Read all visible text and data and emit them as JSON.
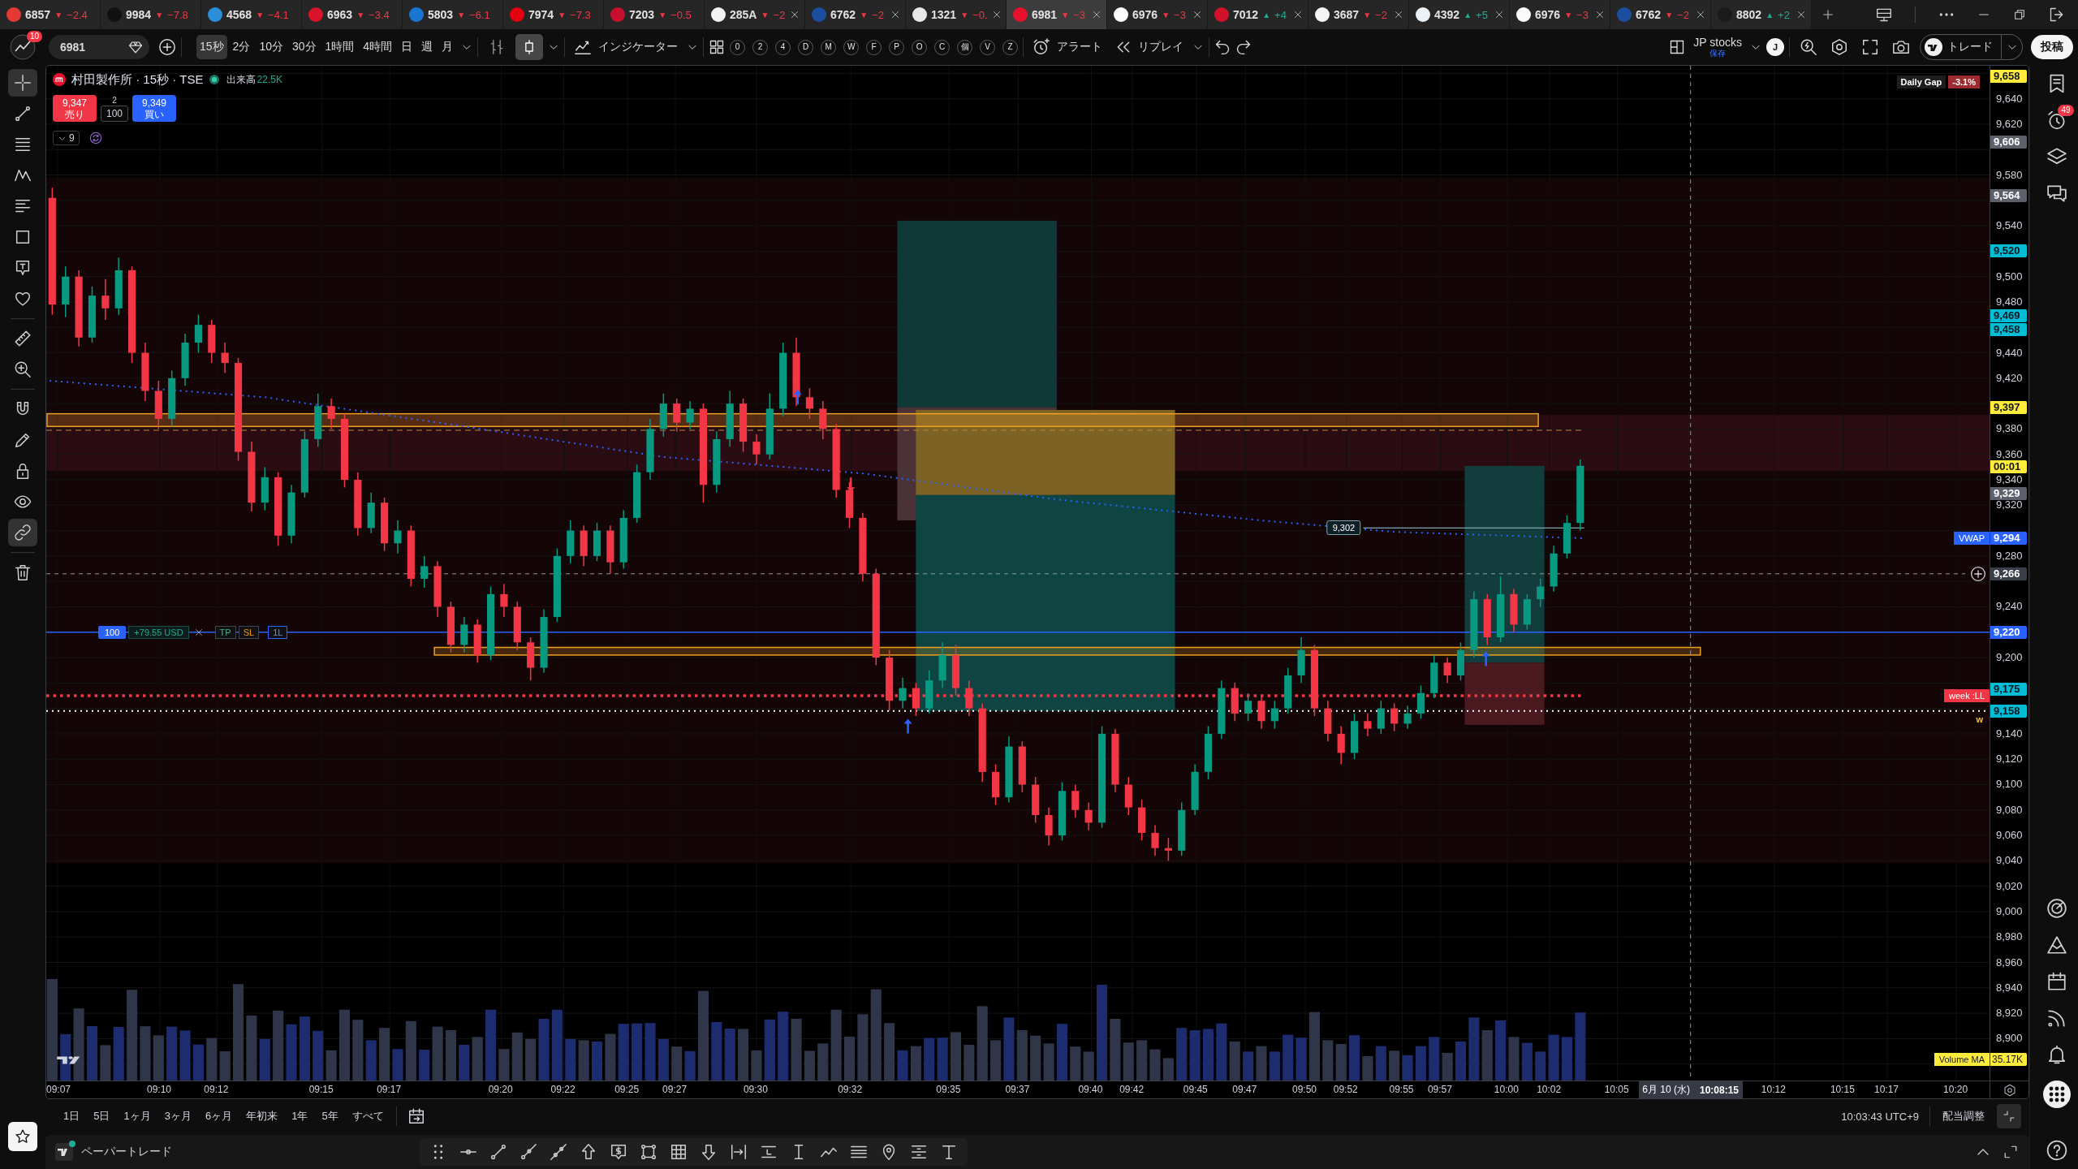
{
  "tabs": [
    {
      "symbol": "6857",
      "arrow": "▼",
      "change": "−2.4",
      "color": "#f23645",
      "logo": {
        "color": "#e53935"
      },
      "close_button": false,
      "selected": false
    },
    {
      "symbol": "9984",
      "arrow": "▼",
      "change": "−7.8",
      "color": "#f23645",
      "logo": {
        "color": "#111111"
      },
      "close_button": false,
      "selected": false
    },
    {
      "symbol": "4568",
      "arrow": "▼",
      "change": "−4.1",
      "color": "#f23645",
      "logo": {
        "color": "#2a8fd8"
      },
      "close_button": false,
      "selected": false
    },
    {
      "symbol": "6963",
      "arrow": "▼",
      "change": "−3.4",
      "color": "#f23645",
      "logo": {
        "color": "#d7142a"
      },
      "close_button": false,
      "selected": false
    },
    {
      "symbol": "5803",
      "arrow": "▼",
      "change": "−6.1",
      "color": "#f23645",
      "logo": {
        "color": "#1976d2"
      },
      "close_button": false,
      "selected": false
    },
    {
      "symbol": "7974",
      "arrow": "▼",
      "change": "−7.3",
      "color": "#f23645",
      "logo": {
        "color": "#e4000f"
      },
      "close_button": false,
      "selected": false
    },
    {
      "symbol": "7203",
      "arrow": "▼",
      "change": "−0.5",
      "color": "#f23645",
      "logo": {
        "color": "#c8102e"
      },
      "close_button": false,
      "selected": false
    },
    {
      "symbol": "285A",
      "arrow": "▼",
      "change": "−2",
      "color": "#f23645",
      "logo": {
        "color": "#f2f2f2"
      },
      "close_button": true,
      "selected": false
    },
    {
      "symbol": "6762",
      "arrow": "▼",
      "change": "−2",
      "color": "#f23645",
      "logo": {
        "color": "#1c4ea0"
      },
      "close_button": true,
      "selected": false
    },
    {
      "symbol": "1321",
      "arrow": "▼",
      "change": "−0.",
      "color": "#f23645",
      "logo": {
        "color": "#e8e8e8"
      },
      "close_button": true,
      "selected": false
    },
    {
      "symbol": "6981",
      "arrow": "▼",
      "change": "−3",
      "color": "#f23645",
      "logo": {
        "color": "#e8112d"
      },
      "close_button": true,
      "selected": true
    },
    {
      "symbol": "6976",
      "arrow": "▼",
      "change": "−3",
      "color": "#f23645",
      "logo": {
        "color": "#fafafa"
      },
      "close_button": true,
      "selected": false
    },
    {
      "symbol": "7012",
      "arrow": "▲",
      "change": "+4",
      "color": "#22ab94",
      "logo": {
        "color": "#d3112a"
      },
      "close_button": true,
      "selected": false
    },
    {
      "symbol": "3687",
      "arrow": "▼",
      "change": "−2",
      "color": "#f23645",
      "logo": {
        "color": "#f5f5f5"
      },
      "close_button": true,
      "selected": false
    },
    {
      "symbol": "4392",
      "arrow": "▲",
      "change": "+5",
      "color": "#22ab94",
      "logo": {
        "color": "#eaf2f8"
      },
      "close_button": true,
      "selected": false
    },
    {
      "symbol": "6976",
      "arrow": "▼",
      "change": "−3",
      "color": "#f23645",
      "logo": {
        "color": "#fafafa"
      },
      "close_button": true,
      "selected": false
    },
    {
      "symbol": "6762",
      "arrow": "▼",
      "change": "−2",
      "color": "#f23645",
      "logo": {
        "color": "#1c4ea0"
      },
      "close_button": true,
      "selected": false
    },
    {
      "symbol": "8802",
      "arrow": "▲",
      "change": "+2",
      "color": "#22ab94",
      "logo": {
        "color": "#1a1a1a"
      },
      "close_button": true,
      "selected": false
    }
  ],
  "toolbar": {
    "notification_count": "10",
    "symbol": "6981",
    "intervals": [
      {
        "label": "15秒",
        "selected": true
      },
      {
        "label": "2分",
        "selected": false
      },
      {
        "label": "10分",
        "selected": false
      },
      {
        "label": "30分",
        "selected": false
      },
      {
        "label": "1時間",
        "selected": false
      },
      {
        "label": "4時間",
        "selected": false
      },
      {
        "label": "日",
        "selected": false
      },
      {
        "label": "週",
        "selected": false
      },
      {
        "label": "月",
        "selected": false
      }
    ],
    "chart_types": [
      {
        "kind": "candles",
        "selected": false
      },
      {
        "kind": "hollow",
        "selected": true
      }
    ],
    "indicators_label": "インジケーター",
    "quick_buttons": [
      "0",
      "2",
      "4",
      "D",
      "M",
      "W",
      "F",
      "P",
      "O",
      "C",
      "個",
      "V",
      "Z"
    ],
    "alert_label": "アラート",
    "replay_label": "リプレイ",
    "layout_name": "JP stocks",
    "layout_status": "保存",
    "user_initial": "J",
    "trade_label": "トレード",
    "publish_label": "投稿"
  },
  "left_toolbar": {
    "tool_groups": [
      {
        "tools": [
          {
            "kind": "crosshair",
            "selected": true
          },
          {
            "kind": "trendline",
            "selected": false
          },
          {
            "kind": "levels",
            "selected": false
          },
          {
            "kind": "pattern",
            "selected": false
          },
          {
            "kind": "lines",
            "selected": false
          },
          {
            "kind": "rectangle",
            "selected": false
          },
          {
            "kind": "note",
            "selected": false
          },
          {
            "kind": "heart",
            "selected": false
          }
        ]
      },
      {
        "tools": [
          {
            "kind": "ruler",
            "selected": false
          },
          {
            "kind": "zoom",
            "selected": false
          }
        ]
      },
      {
        "tools": [
          {
            "kind": "magnet",
            "selected": false
          },
          {
            "kind": "pencil",
            "selected": false
          },
          {
            "kind": "lock",
            "selected": false
          },
          {
            "kind": "eye",
            "selected": false
          },
          {
            "kind": "link",
            "selected": true
          }
        ]
      },
      {
        "tools": [
          {
            "kind": "trash",
            "selected": false
          }
        ]
      }
    ]
  },
  "chart": {
    "title": "村田製作所 · 15秒 · TSE",
    "market_open": true,
    "volume_label": "出来高",
    "volume_value": "22.5K",
    "sell": {
      "price": "9,347",
      "label": "売り"
    },
    "spread": "2",
    "quantity": "100",
    "buy": {
      "price": "9,349",
      "label": "買い"
    },
    "indicator_count": "9",
    "daily_gap": {
      "label": "Daily Gap",
      "value": "-3.1%"
    },
    "position": {
      "quantity": "100",
      "pnl": "+79.55 USD",
      "take_profit": "TP",
      "stop_loss": "SL",
      "lots": "1L"
    },
    "price_note": "9,302",
    "level_tag": "week :LL",
    "week_marker": "w",
    "volume_ma": {
      "label": "Volume MA",
      "value": "35.17K"
    },
    "price_axis": {
      "ticks": [
        "9,640",
        "9,620",
        "9,580",
        "9,540",
        "9,500",
        "9,480",
        "9,440",
        "9,420",
        "9,380",
        "9,360",
        "9,340",
        "9,320",
        "9,280",
        "9,240",
        "9,200",
        "9,140",
        "9,120",
        "9,100",
        "9,080",
        "9,060",
        "9,040",
        "9,020",
        "9,000",
        "8,980",
        "8,960",
        "8,940",
        "8,920",
        "8,900"
      ],
      "labels": [
        {
          "label": "9,658",
          "color": "#ffeb3b"
        },
        {
          "label": "9,606",
          "color": "#5d606b"
        },
        {
          "label": "9,564",
          "color": "#5d606b"
        },
        {
          "label": "9,520",
          "color": "#00bcd4"
        },
        {
          "label": "9,469",
          "color": "#00bcd4"
        },
        {
          "label": "9,458",
          "color": "#00bcd4"
        },
        {
          "label": "9,397",
          "color": "#ffeb3b"
        },
        {
          "label": "00:01",
          "color": "#ffeb3b"
        },
        {
          "label": "9,329",
          "color": "#5d606b"
        },
        {
          "label": "9,294",
          "tag": "VWAP",
          "color": "#2962ff"
        },
        {
          "label": "9,220",
          "color": "#2962ff"
        },
        {
          "label": "9,175",
          "color": "#00bcd4"
        },
        {
          "label": "9,158",
          "color": "#00bcd4"
        }
      ],
      "crosshair_label": "9,266"
    },
    "time_axis": {
      "ticks": [
        "09:07",
        "09:10",
        "09:12",
        "09:15",
        "09:17",
        "09:20",
        "09:22",
        "09:25",
        "09:27",
        "09:30",
        "09:32",
        "09:35",
        "09:37",
        "09:40",
        "09:42",
        "09:45",
        "09:47",
        "09:50",
        "09:52",
        "09:55",
        "09:57",
        "10:00",
        "10:02",
        "10:05",
        "10:12",
        "10:15",
        "10:17",
        "10:20"
      ],
      "crosshair_date": "6月 10 (水)",
      "crosshair_time": "10:08:15"
    }
  },
  "range_bar": {
    "ranges": [
      "1日",
      "5日",
      "1ヶ月",
      "3ヶ月",
      "6ヶ月",
      "年初来",
      "1年",
      "5年",
      "すべて"
    ],
    "clock": "10:03:43 UTC+9",
    "adjust_label": "配当調整"
  },
  "right_sidebar": {
    "alert_count": "49"
  },
  "bottom_panel": {
    "title": "ペーパートレード",
    "connected": true
  }
}
